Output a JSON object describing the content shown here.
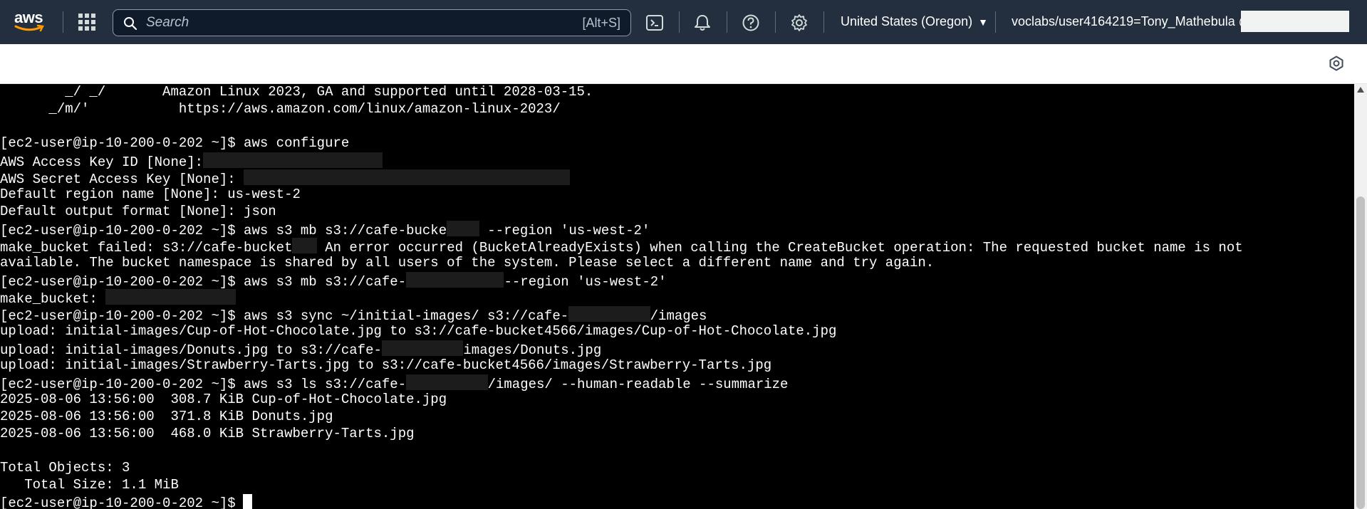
{
  "topnav": {
    "logo_text": "aws",
    "search": {
      "placeholder": "Search",
      "shortcut": "[Alt+S]"
    },
    "icons": [
      "apps-grid-icon",
      "cloudshell-icon",
      "bell-icon",
      "help-icon",
      "gear-icon"
    ],
    "region": "United States (Oregon)",
    "account": "voclabs/user4164219=Tony_Mathebula @"
  },
  "toolbar": {
    "icons": [
      "settings-hexagon-icon"
    ]
  },
  "terminal": {
    "lines": [
      {
        "text": "        _/ _/       Amazon Linux 2023, GA and supported until 2028-03-15."
      },
      {
        "text": "      _/m/'           https://aws.amazon.com/linux/amazon-linux-2023/"
      },
      {
        "text": ""
      },
      {
        "text": "[ec2-user@ip-10-200-0-202 ~]$ aws configure"
      },
      {
        "text": "AWS Access Key ID [None]:",
        "redact_ch": 22
      },
      {
        "text": "AWS Secret Access Key [None]: ",
        "redact_ch": 40
      },
      {
        "text": "Default region name [None]: us-west-2"
      },
      {
        "text": "Default output format [None]: json"
      },
      {
        "text": "[ec2-user@ip-10-200-0-202 ~]$ aws s3 mb s3://cafe-bucke",
        "redact_ch": 4,
        "after": " --region 'us-west-2'"
      },
      {
        "text": "make_bucket failed: s3://cafe-bucket",
        "redact_ch": 3,
        "after": " An error occurred (BucketAlreadyExists) when calling the CreateBucket operation: The requested bucket name is not"
      },
      {
        "text": "available. The bucket namespace is shared by all users of the system. Please select a different name and try again."
      },
      {
        "text": "[ec2-user@ip-10-200-0-202 ~]$ aws s3 mb s3://cafe-",
        "redact_ch": 12,
        "after": "--region 'us-west-2'"
      },
      {
        "text": "make_bucket: ",
        "redact_ch": 16
      },
      {
        "text": "[ec2-user@ip-10-200-0-202 ~]$ aws s3 sync ~/initial-images/ s3://cafe-",
        "redact_ch": 10,
        "after": "/images"
      },
      {
        "text": "upload: initial-images/Cup-of-Hot-Chocolate.jpg to s3://cafe-bucket4566/images/Cup-of-Hot-Chocolate.jpg"
      },
      {
        "text": "upload: initial-images/Donuts.jpg to s3://cafe-",
        "redact_ch": 10,
        "after": "images/Donuts.jpg"
      },
      {
        "text": "upload: initial-images/Strawberry-Tarts.jpg to s3://cafe-bucket4566/images/Strawberry-Tarts.jpg"
      },
      {
        "text": "[ec2-user@ip-10-200-0-202 ~]$ aws s3 ls s3://cafe-",
        "redact_ch": 10,
        "after": "/images/ --human-readable --summarize"
      },
      {
        "text": "2025-08-06 13:56:00  308.7 KiB Cup-of-Hot-Chocolate.jpg"
      },
      {
        "text": "2025-08-06 13:56:00  371.8 KiB Donuts.jpg"
      },
      {
        "text": "2025-08-06 13:56:00  468.0 KiB Strawberry-Tarts.jpg"
      },
      {
        "text": ""
      },
      {
        "text": "Total Objects: 3"
      },
      {
        "text": "   Total Size: 1.1 MiB"
      },
      {
        "text": "[ec2-user@ip-10-200-0-202 ~]$",
        "cursor": true
      }
    ]
  },
  "colors": {
    "nav_bg": "#232f3e",
    "terminal_bg": "#000000",
    "terminal_fg": "#ffffff"
  }
}
